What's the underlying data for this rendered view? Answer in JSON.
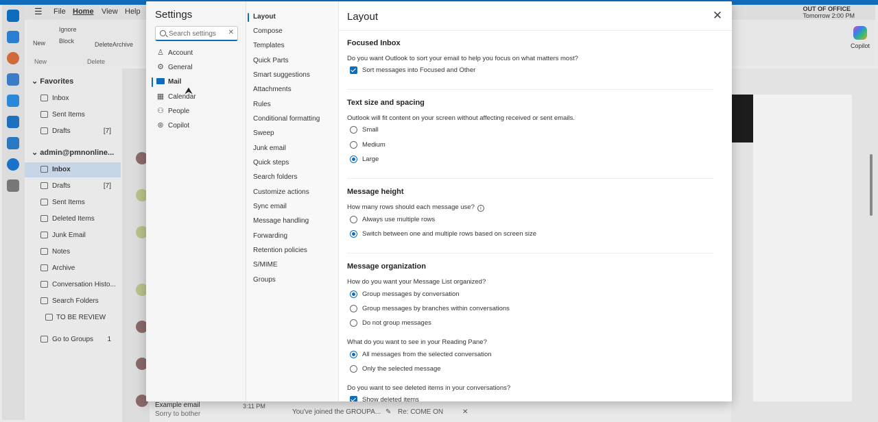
{
  "app": {
    "menu": [
      "File",
      "Home",
      "View",
      "Help"
    ],
    "out_of_office": {
      "title": "OUT OF OFFICE",
      "subtitle": "Tomorrow 2:00 PM"
    },
    "ribbon": {
      "new": "New",
      "ignore": "Ignore",
      "block": "Block",
      "delete": "Delete",
      "archive": "Archive",
      "group_new": "New",
      "group_delete": "Delete",
      "copilot": "Copilot"
    },
    "folders": {
      "favorites": "Favorites",
      "fav_items": [
        {
          "label": "Inbox",
          "count": ""
        },
        {
          "label": "Sent Items",
          "count": ""
        },
        {
          "label": "Drafts",
          "count": "[7]"
        }
      ],
      "account": "admin@pmnonline...",
      "account_items": [
        {
          "label": "Inbox",
          "count": ""
        },
        {
          "label": "Drafts",
          "count": "[7]"
        },
        {
          "label": "Sent Items",
          "count": ""
        },
        {
          "label": "Deleted Items",
          "count": ""
        },
        {
          "label": "Junk Email",
          "count": ""
        },
        {
          "label": "Notes",
          "count": ""
        },
        {
          "label": "Archive",
          "count": ""
        },
        {
          "label": "Conversation Histo...",
          "count": ""
        },
        {
          "label": "Search Folders",
          "count": ""
        },
        {
          "label": "TO BE REVIEW",
          "count": ""
        }
      ],
      "groups": {
        "label": "Go to Groups",
        "count": "1"
      }
    },
    "bottom": {
      "email_title": "Example email",
      "email_preview": "Sorry to bother",
      "email_time": "3:11 PM",
      "tab1": "You've joined the GROUPA...",
      "tab2": "Re: COME ON"
    }
  },
  "settings": {
    "title": "Settings",
    "search_placeholder": "Search settings",
    "categories": [
      "Account",
      "General",
      "Mail",
      "Calendar",
      "People",
      "Copilot"
    ],
    "selected_category": "Mail",
    "mail_sections": [
      "Layout",
      "Compose",
      "Templates",
      "Quick Parts",
      "Smart suggestions",
      "Attachments",
      "Rules",
      "Conditional formatting",
      "Sweep",
      "Junk email",
      "Quick steps",
      "Search folders",
      "Customize actions",
      "Sync email",
      "Message handling",
      "Forwarding",
      "Retention policies",
      "S/MIME",
      "Groups"
    ],
    "selected_section": "Layout"
  },
  "layout": {
    "title": "Layout",
    "focused": {
      "heading": "Focused Inbox",
      "desc": "Do you want Outlook to sort your email to help you focus on what matters most?",
      "option": "Sort messages into Focused and Other",
      "checked": true
    },
    "text_size": {
      "heading": "Text size and spacing",
      "desc": "Outlook will fit content on your screen without affecting received or sent emails.",
      "options": [
        "Small",
        "Medium",
        "Large"
      ],
      "selected": "Large"
    },
    "msg_height": {
      "heading": "Message height",
      "desc": "How many rows should each message use?",
      "options": [
        "Always use multiple rows",
        "Switch between one and multiple rows based on screen size"
      ],
      "selected": "Switch between one and multiple rows based on screen size"
    },
    "msg_org": {
      "heading": "Message organization",
      "desc": "How do you want your Message List organized?",
      "options": [
        "Group messages by conversation",
        "Group messages by branches within conversations",
        "Do not group messages"
      ],
      "selected": "Group messages by conversation",
      "reading_desc": "What do you want to see in your Reading Pane?",
      "reading_options": [
        "All messages from the selected conversation",
        "Only the selected message"
      ],
      "reading_selected": "All messages from the selected conversation",
      "deleted_desc": "Do you want to see deleted items in your conversations?",
      "deleted_option": "Show deleted items",
      "deleted_checked": true
    }
  },
  "colors": {
    "accent": "#0f6cbd"
  }
}
